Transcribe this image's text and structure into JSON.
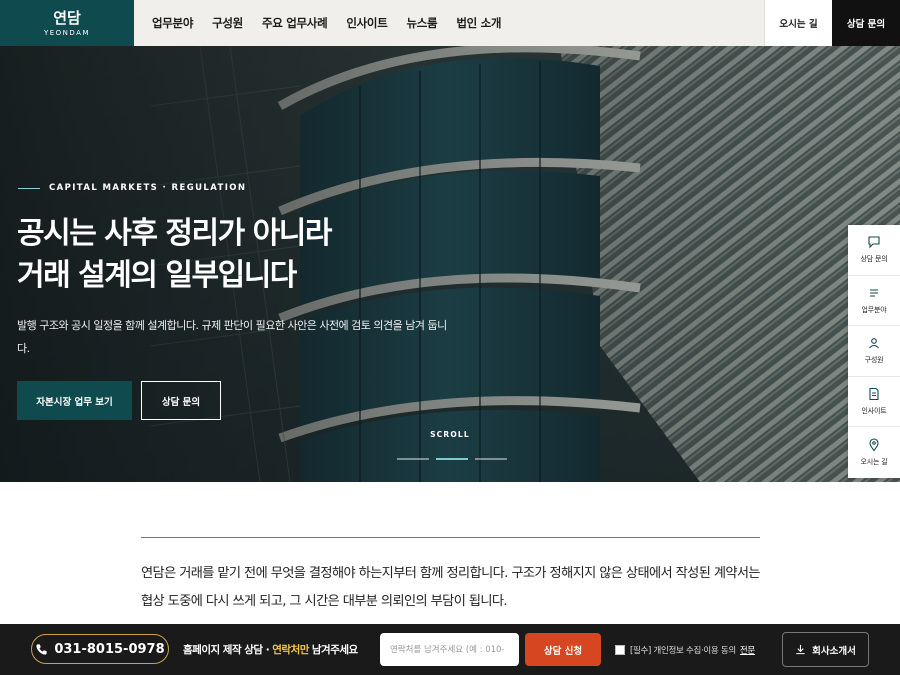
{
  "header": {
    "logo_main": "연담",
    "logo_sub": "YEONDAM",
    "nav": [
      "업무분야",
      "구성원",
      "주요 업무사례",
      "인사이트",
      "뉴스룸",
      "법인 소개"
    ],
    "map_label": "오시는 길",
    "consult_label": "상담 문의"
  },
  "hero": {
    "eyebrow": "CAPITAL MARKETS · REGULATION",
    "title_line1": "공시는 사후 정리가 아니라",
    "title_line2": "거래 설계의 일부입니다",
    "description": "발행 구조와 공시 일정을 함께 설계합니다. 규제 판단이 필요한 사안은 사전에 검토 의견을 남겨 둡니다.",
    "primary_button": "자본시장 업무 보기",
    "secondary_button": "상담 문의",
    "scroll_label": "SCROLL",
    "slides_total": 3,
    "slide_active": 2
  },
  "quick_menu": [
    {
      "label": "상담 문의",
      "icon": "chat-icon"
    },
    {
      "label": "업무분야",
      "icon": "list-icon"
    },
    {
      "label": "구성원",
      "icon": "person-icon"
    },
    {
      "label": "인사이트",
      "icon": "document-icon"
    },
    {
      "label": "오시는 길",
      "icon": "location-pin-icon"
    }
  ],
  "content": {
    "intro": "연담은 거래를 맡기 전에 무엇을 결정해야 하는지부터 함께 정리합니다. 구조가 정해지지 않은 상태에서 작성된 계약서는 협상 도중에 다시 쓰게 되고, 그 시간은 대부분 의뢰인의 부담이 됩니다."
  },
  "bottom_bar": {
    "phone": "031-8015-0978",
    "promo_prefix": "홈페이지 제작 상담 ·",
    "promo_highlight": "연락처만",
    "promo_suffix": "남겨주세요",
    "input_placeholder": "연락처를 남겨주세요 (예 : 010-",
    "submit_label": "상담 신청",
    "agree_label": "[필수] 개인정보 수집·이용 동의",
    "agree_link": "전문",
    "company_button": "회사소개서"
  },
  "colors": {
    "brand": "#0f4a4f",
    "accent_orange": "#d64621",
    "accent_gold": "#c9a24a",
    "highlight_yellow": "#f2c54b"
  }
}
